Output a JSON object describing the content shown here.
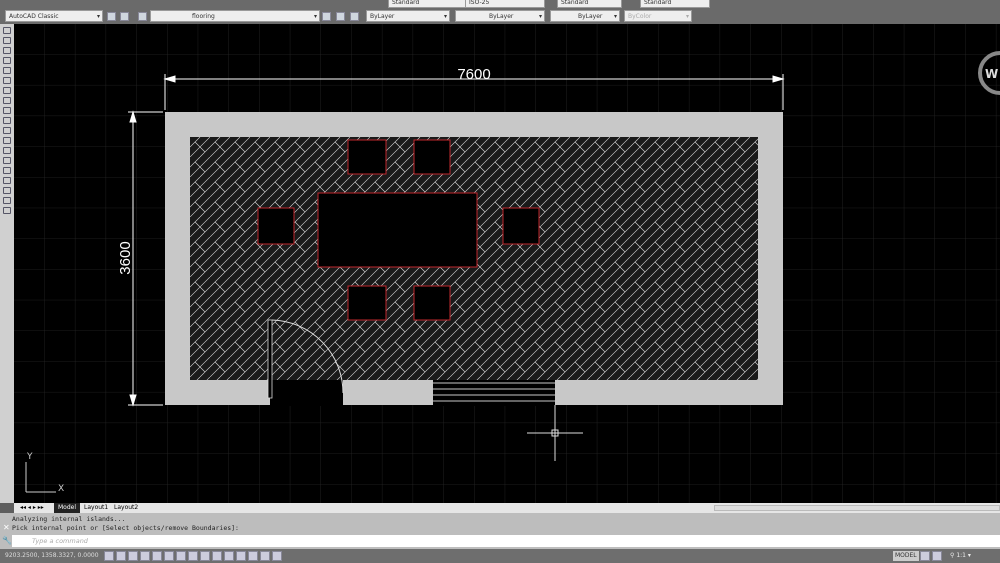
{
  "toolbar": {
    "workspace": "AutoCAD Classic",
    "layer": "flooring",
    "color": "ByLayer",
    "linetype": "ByLayer",
    "lineweight": "ByLayer",
    "plotstyle": "ByColor",
    "text_style": "Standard",
    "dim_style": "ISO-25",
    "table_style": "Standard",
    "mleader_style": "Standard"
  },
  "drawing": {
    "dim_width": "7600",
    "dim_height": "3600",
    "compass": "W",
    "ucs_x": "X",
    "ucs_y": "Y",
    "wall_color": "#c8c8c8",
    "furniture_color": "#c0272d",
    "hatch_color": "#d8d8d8"
  },
  "tabs": [
    "Model",
    "Layout1",
    "Layout2"
  ],
  "command": {
    "history": [
      "Analyzing internal islands...",
      "Pick internal point or [Select objects/remove Boundaries]:"
    ],
    "placeholder": "Type a command"
  },
  "status": {
    "coords": "9203.2500, 1358.3327, 0.0000",
    "model": "MODEL",
    "scale": "1:1"
  }
}
